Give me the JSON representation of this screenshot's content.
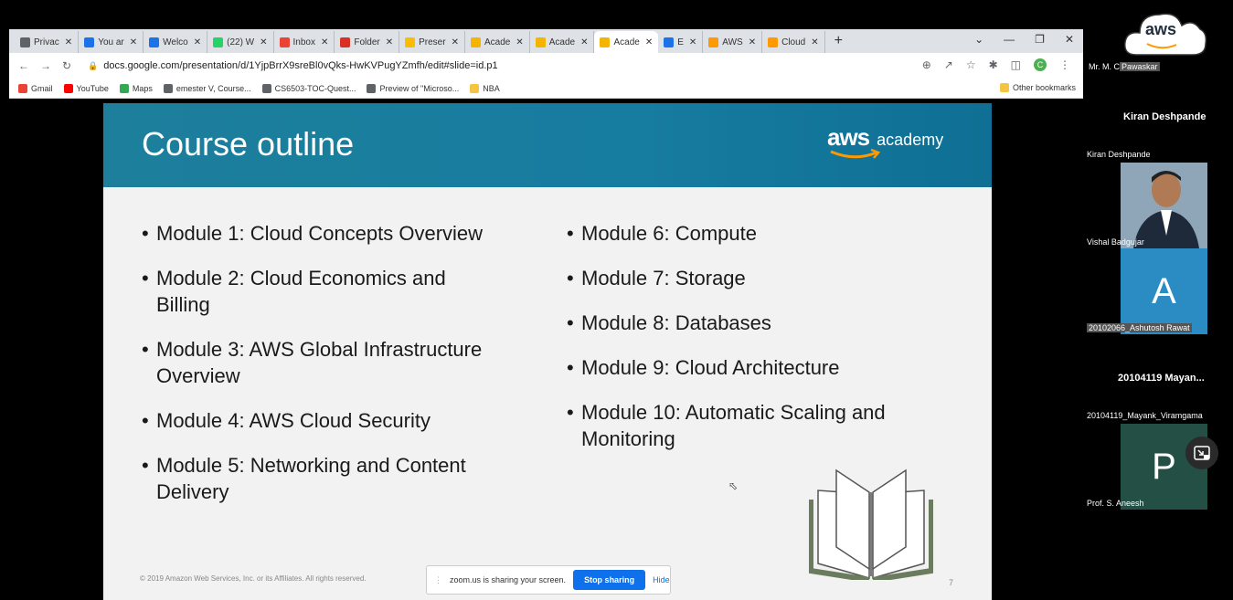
{
  "browser": {
    "tabs": [
      {
        "label": "Privac",
        "icon": "chrome-icon",
        "color": "#5f6368"
      },
      {
        "label": "You ar",
        "icon": "s-icon",
        "color": "#1a73e8"
      },
      {
        "label": "Welco",
        "icon": "s-icon",
        "color": "#1a73e8"
      },
      {
        "label": "(22) W",
        "icon": "whatsapp-icon",
        "color": "#25d366"
      },
      {
        "label": "Inbox",
        "icon": "gmail-icon",
        "color": "#ea4335"
      },
      {
        "label": "Folder",
        "icon": "folder-icon",
        "color": "#d93025"
      },
      {
        "label": "Preser",
        "icon": "drive-icon",
        "color": "#fbbc04"
      },
      {
        "label": "Acade",
        "icon": "slides-icon",
        "color": "#f4b400"
      },
      {
        "label": "Acade",
        "icon": "slides-icon",
        "color": "#f4b400"
      },
      {
        "label": "Acade",
        "icon": "slides-icon",
        "color": "#f4b400",
        "active": true
      },
      {
        "label": "E",
        "icon": "meet-icon",
        "color": "#1a73e8"
      },
      {
        "label": "AWS",
        "icon": "aws-icon",
        "color": "#ff9900"
      },
      {
        "label": "Cloud",
        "icon": "aws-icon",
        "color": "#ff9900"
      }
    ],
    "new_tab": "+",
    "url": "docs.google.com/presentation/d/1YjpBrrX9sreBl0vQks-HwKVPugYZmfh/edit#slide=id.p1",
    "bookmarks": [
      {
        "label": "Gmail",
        "color": "#ea4335"
      },
      {
        "label": "YouTube",
        "color": "#ff0000"
      },
      {
        "label": "Maps",
        "color": "#34a853"
      },
      {
        "label": "emester V, Course...",
        "color": "#5f6368"
      },
      {
        "label": "CS6503-TOC-Quest...",
        "color": "#5f6368"
      },
      {
        "label": "Preview of \"Microso...",
        "color": "#5f6368"
      },
      {
        "label": "NBA",
        "color": "#f4c542"
      }
    ],
    "other_bookmarks": "Other bookmarks",
    "profile_letter": "C"
  },
  "slide": {
    "title": "Course outline",
    "logo_aws": "aws",
    "logo_academy": "academy",
    "left_modules": [
      [
        "Module 1: Cloud Concepts Overview"
      ],
      [
        "Module 2: Cloud Economics and",
        "Billing"
      ],
      [
        "Module 3: AWS Global Infrastructure",
        "Overview"
      ],
      [
        "Module 4: AWS Cloud Security"
      ],
      [
        "Module 5: Networking and Content",
        "Delivery"
      ]
    ],
    "right_modules": [
      [
        "Module 6: Compute"
      ],
      [
        "Module 7: Storage"
      ],
      [
        "Module 8: Databases"
      ],
      [
        "Module 9: Cloud Architecture"
      ],
      [
        "Module 10: Automatic Scaling and",
        "Monitoring"
      ]
    ],
    "copyright": "© 2019 Amazon Web Services, Inc. or its Affiliates. All rights reserved.",
    "page_number": "7"
  },
  "zoom_share": {
    "message": "zoom.us is sharing your screen.",
    "stop_label": "Stop sharing",
    "hide_label": "Hide"
  },
  "participants": {
    "p1_name_prefix": "Mr. M. C",
    "p1_name_highlight": "Pawaskar",
    "p1_logo": "aws",
    "p2_big": "Kiran Deshpande",
    "p2_name": "Kiran Deshpande",
    "p3_name": "Vishal Badgujar",
    "p4_letter": "A",
    "p4_name": "20102066_Ashutosh Rawat",
    "p5_big": "20104119  Mayan...",
    "p5_name": "20104119_Mayank_Viramgama",
    "p6_letter": "P",
    "p6_name": "Prof. S. Aneesh"
  }
}
